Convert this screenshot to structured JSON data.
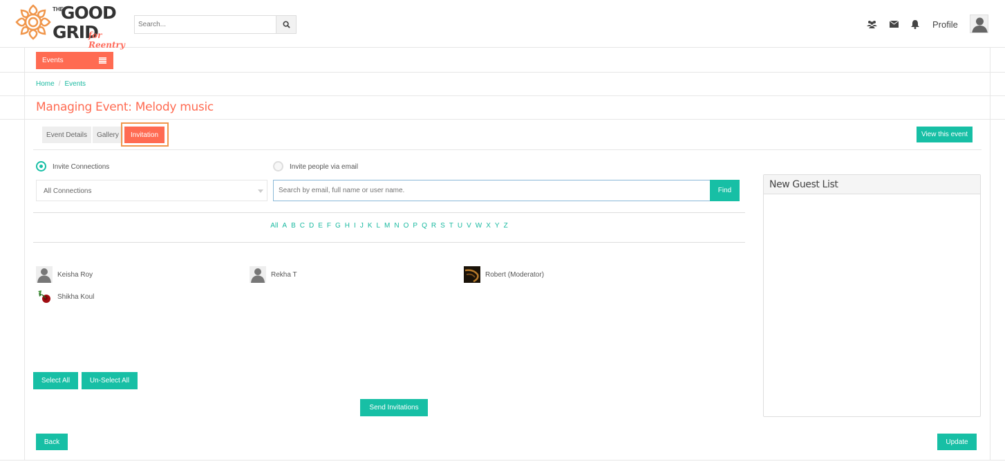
{
  "header": {
    "logo": {
      "the": "THE",
      "good": "GOOD",
      "grid": "GRID",
      "tagline": "for Reentry"
    },
    "search_placeholder": "Search...",
    "profile_label": "Profile",
    "icons": [
      "users-icon",
      "envelope-icon",
      "bell-icon",
      "search-icon",
      "user-avatar-icon"
    ]
  },
  "nav": {
    "events_label": "Events"
  },
  "breadcrumb": {
    "home": "Home",
    "separator": "/",
    "current": "Events"
  },
  "page": {
    "title": "Managing Event: Melody music"
  },
  "tabs": [
    {
      "label": "Event Details",
      "active": false
    },
    {
      "label": "Gallery",
      "active": false
    },
    {
      "label": "Invitation",
      "active": true
    }
  ],
  "view_event_label": "View this event",
  "invite": {
    "option_connections": "Invite Connections",
    "option_email": "Invite people via email",
    "selected": "Invite Connections",
    "filter_value": "All Connections",
    "search_placeholder": "Search by email, full name or user name.",
    "find_label": "Find"
  },
  "alphabet": [
    "All",
    "A",
    "B",
    "C",
    "D",
    "E",
    "F",
    "G",
    "H",
    "I",
    "J",
    "K",
    "L",
    "M",
    "N",
    "O",
    "P",
    "Q",
    "R",
    "S",
    "T",
    "U",
    "V",
    "W",
    "X",
    "Y",
    "Z"
  ],
  "connections": [
    {
      "name": "Keisha Roy",
      "avatar": "default-user-icon"
    },
    {
      "name": "Rekha T",
      "avatar": "default-user-icon"
    },
    {
      "name": "Robert (Moderator)",
      "avatar": "photo-dark"
    },
    {
      "name": "Shikha Koul",
      "avatar": "photo-rose"
    }
  ],
  "actions": {
    "select_all": "Select All",
    "unselect_all": "Un-Select All",
    "send": "Send Invitations",
    "back": "Back",
    "update": "Update"
  },
  "guest_list": {
    "title": "New Guest List"
  },
  "colors": {
    "accent_orange": "#ff6b52",
    "teal": "#17bfa5",
    "highlight_outline": "#f0964b"
  }
}
